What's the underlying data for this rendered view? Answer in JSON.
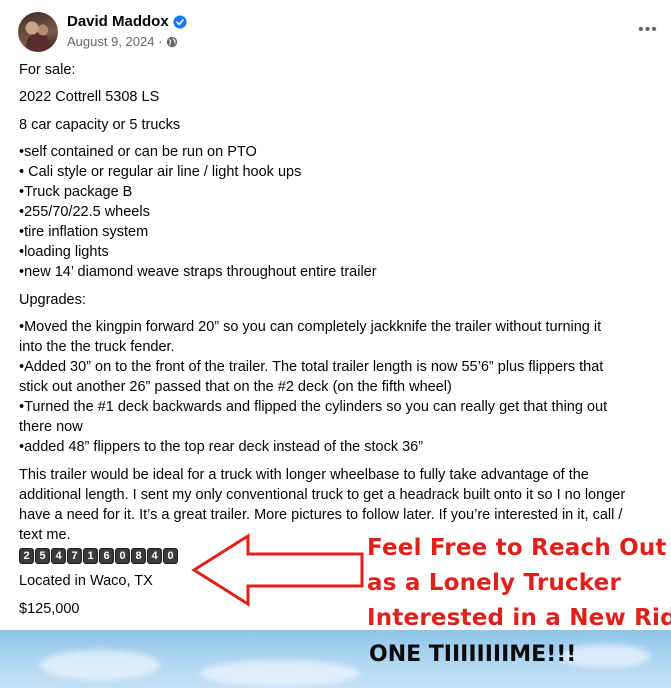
{
  "post": {
    "author": "David Maddox",
    "date": "August 9, 2024 ·",
    "more_label": "•••"
  },
  "body": {
    "lines": [
      "For sale:",
      "2022 Cottrell 5308 LS",
      "8 car capacity or 5 trucks",
      "•self contained or can be run on PTO",
      "• Cali style  or regular air line / light hook ups",
      "•Truck package B",
      "•255/70/22.5 wheels",
      "•tire inflation system",
      "•loading lights",
      "•new 14’ diamond weave straps throughout entire trailer",
      "Upgrades:",
      "•Moved the kingpin forward 20” so you can completely jackknife the trailer without turning it",
      "into the the truck fender.",
      "•Added 30” on to the front of the trailer. The total trailer length is now 55’6” plus flippers that",
      "stick out another 26” passed that on the #2 deck (on the fifth wheel)",
      "•Turned the #1 deck backwards and flipped the cylinders so you can really get that thing out",
      "there now",
      "•added 48” flippers to the top rear deck instead of the stock 36”",
      "This trailer would be ideal for a truck with longer wheelbase to fully take advantage of the",
      "additional length.  I sent my only conventional truck to get a headrack built onto it so I no longer",
      "have a need for it. It’s a great trailer. More pictures to follow later. If you’re interested in it, call /",
      "text me.",
      "Located in Waco, TX",
      "$125,000"
    ],
    "phone_digits": [
      "2",
      "5",
      "4",
      "7",
      "1",
      "6",
      "0",
      "8",
      "4",
      "0"
    ]
  },
  "annotation": {
    "red_lines": [
      "Feel Free to Reach Out",
      "as a Lonely Trucker",
      "Interested in a New Ride"
    ],
    "black_line": "ONE TIIIIIIIIME!!!",
    "red_color": "#e0201b"
  },
  "icons": {
    "verified": "verified-badge-icon",
    "audience": "globe-icon",
    "arrow": "left-arrow-icon"
  }
}
